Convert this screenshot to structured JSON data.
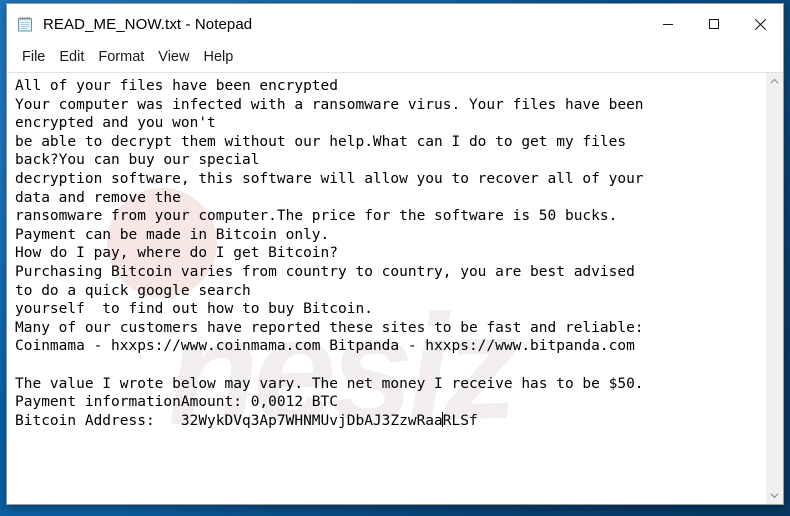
{
  "window": {
    "title": "READ_ME_NOW.txt - Notepad",
    "app_icon": "notepad-icon",
    "controls": {
      "minimize": "minimize-icon",
      "maximize": "maximize-icon",
      "close": "close-icon"
    }
  },
  "menu": {
    "items": [
      {
        "label": "File"
      },
      {
        "label": "Edit"
      },
      {
        "label": "Format"
      },
      {
        "label": "View"
      },
      {
        "label": "Help"
      }
    ]
  },
  "scrollbar": {
    "up_arrow": "chevron-up-icon",
    "down_arrow": "chevron-down-icon"
  },
  "watermark": {
    "text": "nesiz"
  },
  "document": {
    "text_before_caret": "All of your files have been encrypted\nYour computer was infected with a ransomware virus. Your files have been\nencrypted and you won't\nbe able to decrypt them without our help.What can I do to get my files\nback?You can buy our special\ndecryption software, this software will allow you to recover all of your\ndata and remove the\nransomware from your computer.The price for the software is 50 bucks.\nPayment can be made in Bitcoin only.\nHow do I pay, where do I get Bitcoin?\nPurchasing Bitcoin varies from country to country, you are best advised\nto do a quick google search\nyourself  to find out how to buy Bitcoin.\nMany of our customers have reported these sites to be fast and reliable:\nCoinmama - hxxps://www.coinmama.com Bitpanda - hxxps://www.bitpanda.com\n\nThe value I wrote below may vary. The net money I receive has to be $50.\nPayment informationAmount: 0,0012 BTC\nBitcoin Address:   32WykDVq3Ap7WHNMUvjDbAJ3ZzwRaa",
    "text_after_caret": "RLSf",
    "lines": [
      "All of your files have been encrypted",
      "Your computer was infected with a ransomware virus. Your files have been",
      "encrypted and you won't",
      "be able to decrypt them without our help.What can I do to get my files",
      "back?You can buy our special",
      "decryption software, this software will allow you to recover all of your",
      "data and remove the",
      "ransomware from your computer.The price for the software is 50 bucks.",
      "Payment can be made in Bitcoin only.",
      "How do I pay, where do I get Bitcoin?",
      "Purchasing Bitcoin varies from country to country, you are best advised",
      "to do a quick google search",
      "yourself  to find out how to buy Bitcoin.",
      "Many of our customers have reported these sites to be fast and reliable:",
      "Coinmama - hxxps://www.coinmama.com Bitpanda - hxxps://www.bitpanda.com",
      "",
      "The value I wrote below may vary. The net money I receive has to be $50.",
      "Payment informationAmount: 0,0012 BTC",
      "Bitcoin Address:   32WykDVq3Ap7WHNMUvjDbAJ3ZzwRaaRLSf"
    ],
    "bitcoin_address": "32WykDVq3Ap7WHNMUvjDbAJ3ZzwRaaRLSf",
    "amount": "0,0012 BTC",
    "price_usd": "$50",
    "price_text": "50 bucks",
    "sites": [
      {
        "name": "Coinmama",
        "url": "hxxps://www.coinmama.com"
      },
      {
        "name": "Bitpanda",
        "url": "hxxps://www.bitpanda.com"
      }
    ]
  },
  "colors": {
    "desktop_blue": "#0a5b9c",
    "window_bg": "#ffffff",
    "text": "#000000",
    "scrollbar_track": "#f0f0f0"
  }
}
